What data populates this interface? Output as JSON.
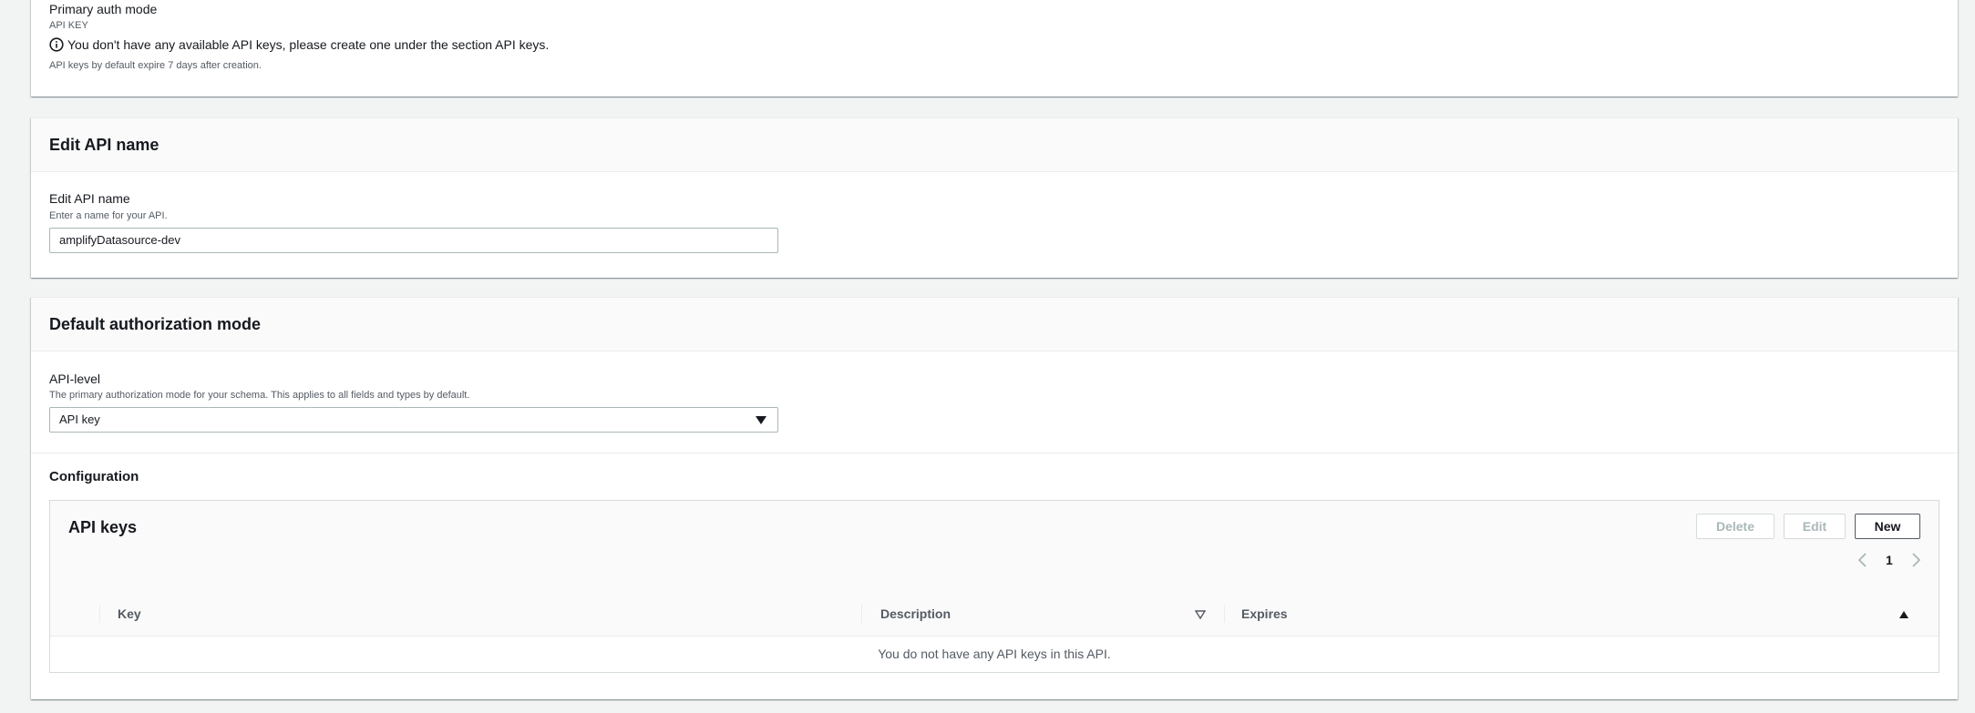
{
  "top_panel": {
    "label": "Primary auth mode",
    "sub": "API KEY",
    "notice": "You don't have any available API keys, please create one under the section API keys.",
    "note": "API keys by default expire 7 days after creation."
  },
  "edit_name": {
    "header": "Edit API name",
    "label": "Edit API name",
    "description": "Enter a name for your API.",
    "value": "amplifyDatasource-dev"
  },
  "auth_mode": {
    "header": "Default authorization mode",
    "label": "API-level",
    "description": "The primary authorization mode for your schema. This applies to all fields and types by default.",
    "selected": "API key",
    "config_title": "Configuration"
  },
  "api_keys": {
    "title": "API keys",
    "buttons": {
      "delete": "Delete",
      "edit": "Edit",
      "new": "New"
    },
    "page": "1",
    "columns": [
      "Key",
      "Description",
      "Expires"
    ],
    "empty": "You do not have any API keys in this API."
  }
}
